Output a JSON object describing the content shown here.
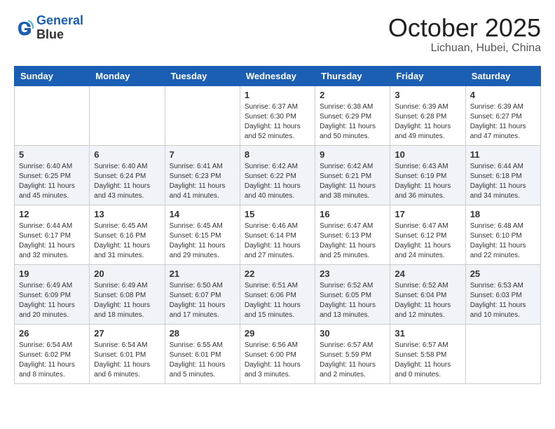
{
  "header": {
    "logo_line1": "General",
    "logo_line2": "Blue",
    "month": "October 2025",
    "location": "Lichuan, Hubei, China"
  },
  "weekdays": [
    "Sunday",
    "Monday",
    "Tuesday",
    "Wednesday",
    "Thursday",
    "Friday",
    "Saturday"
  ],
  "weeks": [
    [
      {
        "day": "",
        "sunrise": "",
        "sunset": "",
        "daylight": ""
      },
      {
        "day": "",
        "sunrise": "",
        "sunset": "",
        "daylight": ""
      },
      {
        "day": "",
        "sunrise": "",
        "sunset": "",
        "daylight": ""
      },
      {
        "day": "1",
        "sunrise": "Sunrise: 6:37 AM",
        "sunset": "Sunset: 6:30 PM",
        "daylight": "Daylight: 11 hours and 52 minutes."
      },
      {
        "day": "2",
        "sunrise": "Sunrise: 6:38 AM",
        "sunset": "Sunset: 6:29 PM",
        "daylight": "Daylight: 11 hours and 50 minutes."
      },
      {
        "day": "3",
        "sunrise": "Sunrise: 6:39 AM",
        "sunset": "Sunset: 6:28 PM",
        "daylight": "Daylight: 11 hours and 49 minutes."
      },
      {
        "day": "4",
        "sunrise": "Sunrise: 6:39 AM",
        "sunset": "Sunset: 6:27 PM",
        "daylight": "Daylight: 11 hours and 47 minutes."
      }
    ],
    [
      {
        "day": "5",
        "sunrise": "Sunrise: 6:40 AM",
        "sunset": "Sunset: 6:25 PM",
        "daylight": "Daylight: 11 hours and 45 minutes."
      },
      {
        "day": "6",
        "sunrise": "Sunrise: 6:40 AM",
        "sunset": "Sunset: 6:24 PM",
        "daylight": "Daylight: 11 hours and 43 minutes."
      },
      {
        "day": "7",
        "sunrise": "Sunrise: 6:41 AM",
        "sunset": "Sunset: 6:23 PM",
        "daylight": "Daylight: 11 hours and 41 minutes."
      },
      {
        "day": "8",
        "sunrise": "Sunrise: 6:42 AM",
        "sunset": "Sunset: 6:22 PM",
        "daylight": "Daylight: 11 hours and 40 minutes."
      },
      {
        "day": "9",
        "sunrise": "Sunrise: 6:42 AM",
        "sunset": "Sunset: 6:21 PM",
        "daylight": "Daylight: 11 hours and 38 minutes."
      },
      {
        "day": "10",
        "sunrise": "Sunrise: 6:43 AM",
        "sunset": "Sunset: 6:19 PM",
        "daylight": "Daylight: 11 hours and 36 minutes."
      },
      {
        "day": "11",
        "sunrise": "Sunrise: 6:44 AM",
        "sunset": "Sunset: 6:18 PM",
        "daylight": "Daylight: 11 hours and 34 minutes."
      }
    ],
    [
      {
        "day": "12",
        "sunrise": "Sunrise: 6:44 AM",
        "sunset": "Sunset: 6:17 PM",
        "daylight": "Daylight: 11 hours and 32 minutes."
      },
      {
        "day": "13",
        "sunrise": "Sunrise: 6:45 AM",
        "sunset": "Sunset: 6:16 PM",
        "daylight": "Daylight: 11 hours and 31 minutes."
      },
      {
        "day": "14",
        "sunrise": "Sunrise: 6:45 AM",
        "sunset": "Sunset: 6:15 PM",
        "daylight": "Daylight: 11 hours and 29 minutes."
      },
      {
        "day": "15",
        "sunrise": "Sunrise: 6:46 AM",
        "sunset": "Sunset: 6:14 PM",
        "daylight": "Daylight: 11 hours and 27 minutes."
      },
      {
        "day": "16",
        "sunrise": "Sunrise: 6:47 AM",
        "sunset": "Sunset: 6:13 PM",
        "daylight": "Daylight: 11 hours and 25 minutes."
      },
      {
        "day": "17",
        "sunrise": "Sunrise: 6:47 AM",
        "sunset": "Sunset: 6:12 PM",
        "daylight": "Daylight: 11 hours and 24 minutes."
      },
      {
        "day": "18",
        "sunrise": "Sunrise: 6:48 AM",
        "sunset": "Sunset: 6:10 PM",
        "daylight": "Daylight: 11 hours and 22 minutes."
      }
    ],
    [
      {
        "day": "19",
        "sunrise": "Sunrise: 6:49 AM",
        "sunset": "Sunset: 6:09 PM",
        "daylight": "Daylight: 11 hours and 20 minutes."
      },
      {
        "day": "20",
        "sunrise": "Sunrise: 6:49 AM",
        "sunset": "Sunset: 6:08 PM",
        "daylight": "Daylight: 11 hours and 18 minutes."
      },
      {
        "day": "21",
        "sunrise": "Sunrise: 6:50 AM",
        "sunset": "Sunset: 6:07 PM",
        "daylight": "Daylight: 11 hours and 17 minutes."
      },
      {
        "day": "22",
        "sunrise": "Sunrise: 6:51 AM",
        "sunset": "Sunset: 6:06 PM",
        "daylight": "Daylight: 11 hours and 15 minutes."
      },
      {
        "day": "23",
        "sunrise": "Sunrise: 6:52 AM",
        "sunset": "Sunset: 6:05 PM",
        "daylight": "Daylight: 11 hours and 13 minutes."
      },
      {
        "day": "24",
        "sunrise": "Sunrise: 6:52 AM",
        "sunset": "Sunset: 6:04 PM",
        "daylight": "Daylight: 11 hours and 12 minutes."
      },
      {
        "day": "25",
        "sunrise": "Sunrise: 6:53 AM",
        "sunset": "Sunset: 6:03 PM",
        "daylight": "Daylight: 11 hours and 10 minutes."
      }
    ],
    [
      {
        "day": "26",
        "sunrise": "Sunrise: 6:54 AM",
        "sunset": "Sunset: 6:02 PM",
        "daylight": "Daylight: 11 hours and 8 minutes."
      },
      {
        "day": "27",
        "sunrise": "Sunrise: 6:54 AM",
        "sunset": "Sunset: 6:01 PM",
        "daylight": "Daylight: 11 hours and 6 minutes."
      },
      {
        "day": "28",
        "sunrise": "Sunrise: 6:55 AM",
        "sunset": "Sunset: 6:01 PM",
        "daylight": "Daylight: 11 hours and 5 minutes."
      },
      {
        "day": "29",
        "sunrise": "Sunrise: 6:56 AM",
        "sunset": "Sunset: 6:00 PM",
        "daylight": "Daylight: 11 hours and 3 minutes."
      },
      {
        "day": "30",
        "sunrise": "Sunrise: 6:57 AM",
        "sunset": "Sunset: 5:59 PM",
        "daylight": "Daylight: 11 hours and 2 minutes."
      },
      {
        "day": "31",
        "sunrise": "Sunrise: 6:57 AM",
        "sunset": "Sunset: 5:58 PM",
        "daylight": "Daylight: 11 hours and 0 minutes."
      },
      {
        "day": "",
        "sunrise": "",
        "sunset": "",
        "daylight": ""
      }
    ]
  ]
}
